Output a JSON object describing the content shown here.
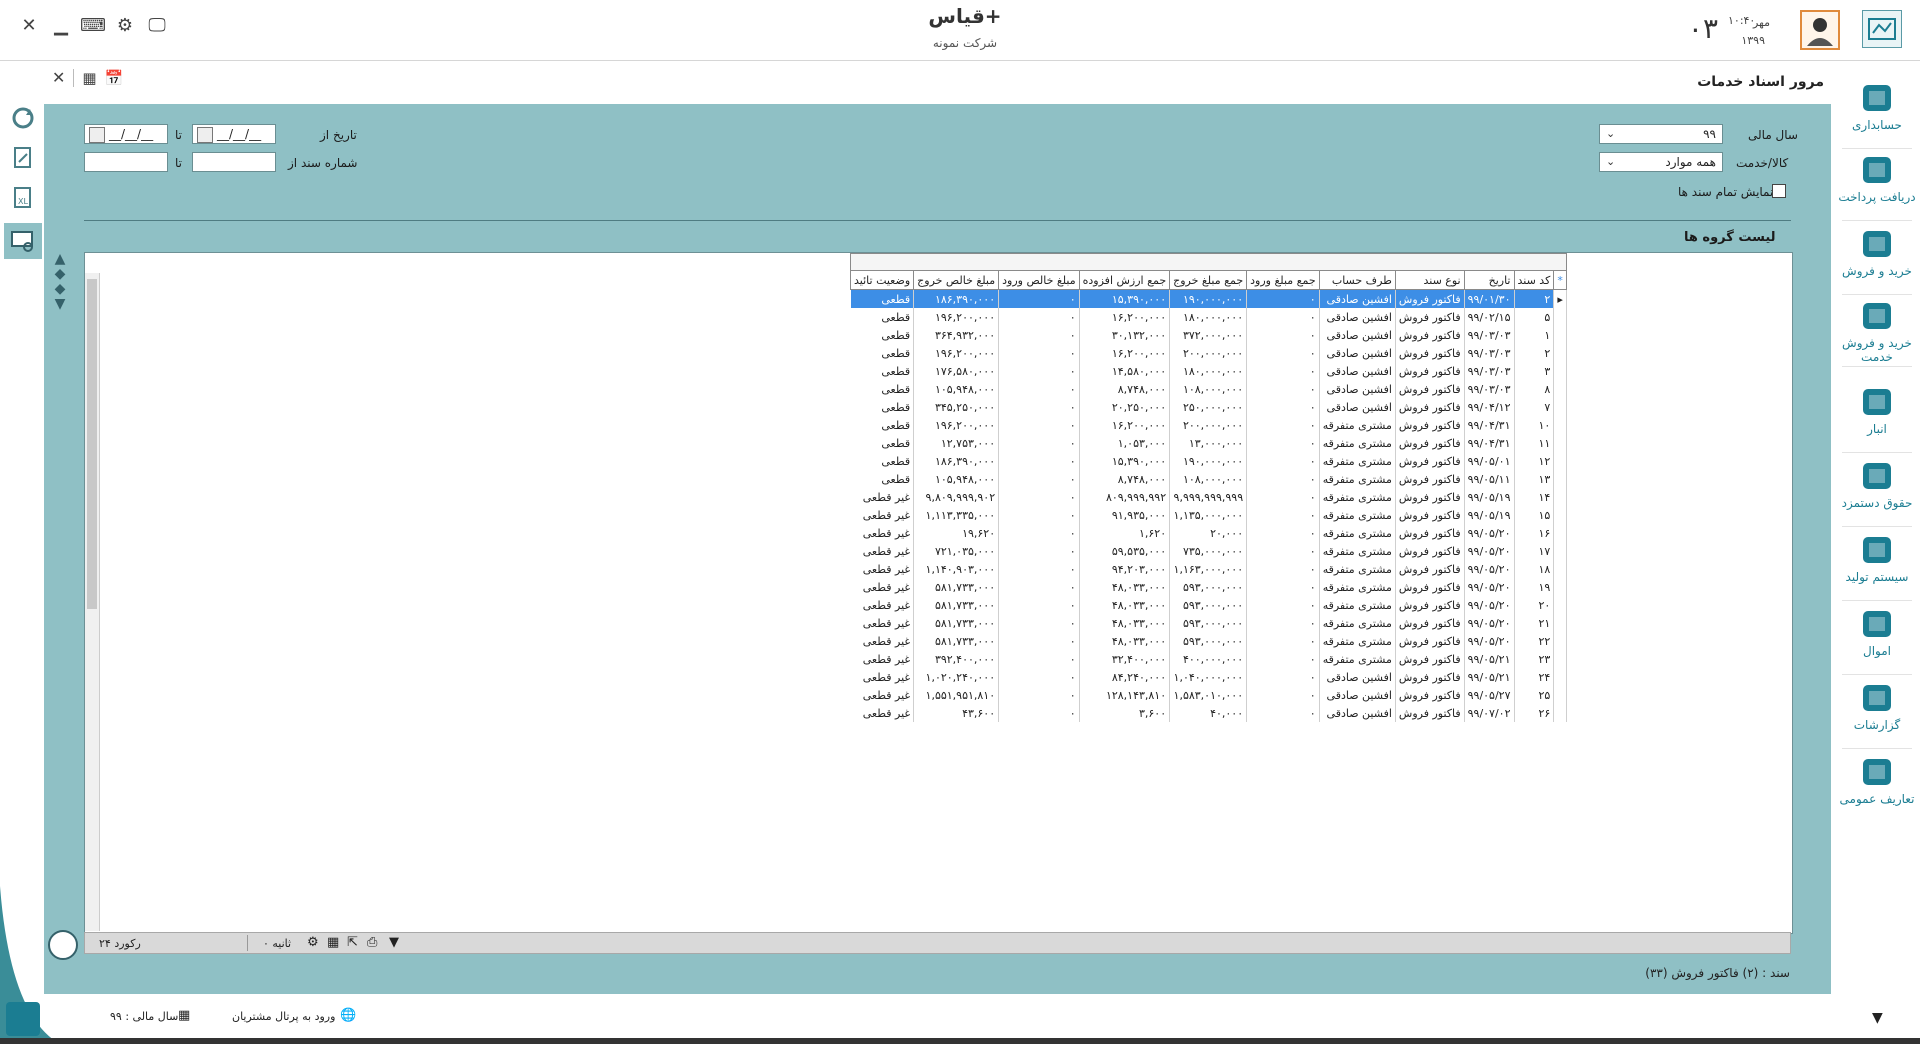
{
  "header": {
    "app_title": "قیاس+",
    "company": "شرکت نمونه",
    "date_day": "۰۳",
    "date_month": "مهر",
    "date_year": "۱۳۹۹",
    "clock": "۱۰:۴۰"
  },
  "page_title": "مرور اسناد خدمات",
  "nav": [
    {
      "label": "حسابداری",
      "icon": "calculator-icon"
    },
    {
      "label": "دریافت پرداخت",
      "icon": "safe-icon"
    },
    {
      "label": "خرید و فروش",
      "icon": "globe-cart-icon"
    },
    {
      "label": "خرید و فروش خدمت",
      "icon": "gear-service-icon"
    },
    {
      "label": "انبار",
      "icon": "warehouse-icon"
    },
    {
      "label": "حقوق دستمزد",
      "icon": "coins-icon"
    },
    {
      "label": "سیستم تولید",
      "icon": "worker-icon"
    },
    {
      "label": "اموال",
      "icon": "box-icon"
    },
    {
      "label": "گزارشات",
      "icon": "chart-icon"
    },
    {
      "label": "تعاریف عمومی",
      "icon": "table-icon"
    }
  ],
  "filters": {
    "fiscal_year_label": "سال مالی",
    "fiscal_year_value": "۹۹",
    "goods_label": "کالا/خدمت",
    "goods_value": "همه موارد",
    "show_all_label": "نمایش تمام سند ها",
    "date_from_label": "تاریخ از",
    "date_to_label": "تا",
    "date_placeholder": "__/__/__",
    "doc_from_label": "شماره سند از",
    "doc_to_label": "تا"
  },
  "list_title": "لیست گروه ها",
  "table": {
    "columns": [
      "کد سند",
      "تاریخ",
      "نوع سند",
      "طرف حساب",
      "جمع مبلغ ورود",
      "جمع مبلغ خروج",
      "جمع ارزش افزوده",
      "مبلغ خالص ورود",
      "مبلغ خالص خروج",
      "وضعیت تائید"
    ],
    "rows": [
      [
        "۲",
        "۹۹/۰۱/۳۰",
        "فاکتور فروش",
        "افشین صادقی",
        "۰",
        "۱۹۰,۰۰۰,۰۰۰",
        "۱۵,۳۹۰,۰۰۰",
        "۰",
        "۱۸۶,۳۹۰,۰۰۰",
        "قطعی"
      ],
      [
        "۵",
        "۹۹/۰۲/۱۵",
        "فاکتور فروش",
        "افشین صادقی",
        "۰",
        "۱۸۰,۰۰۰,۰۰۰",
        "۱۶,۲۰۰,۰۰۰",
        "۰",
        "۱۹۶,۲۰۰,۰۰۰",
        "قطعی"
      ],
      [
        "۱",
        "۹۹/۰۳/۰۳",
        "فاکتور فروش",
        "افشین صادقی",
        "۰",
        "۳۷۲,۰۰۰,۰۰۰",
        "۳۰,۱۳۲,۰۰۰",
        "۰",
        "۳۶۴,۹۳۲,۰۰۰",
        "قطعی"
      ],
      [
        "۲",
        "۹۹/۰۳/۰۳",
        "فاکتور فروش",
        "افشین صادقی",
        "۰",
        "۲۰۰,۰۰۰,۰۰۰",
        "۱۶,۲۰۰,۰۰۰",
        "۰",
        "۱۹۶,۲۰۰,۰۰۰",
        "قطعی"
      ],
      [
        "۳",
        "۹۹/۰۳/۰۳",
        "فاکتور فروش",
        "افشین صادقی",
        "۰",
        "۱۸۰,۰۰۰,۰۰۰",
        "۱۴,۵۸۰,۰۰۰",
        "۰",
        "۱۷۶,۵۸۰,۰۰۰",
        "قطعی"
      ],
      [
        "۸",
        "۹۹/۰۳/۰۳",
        "فاکتور فروش",
        "افشین صادقی",
        "۰",
        "۱۰۸,۰۰۰,۰۰۰",
        "۸,۷۴۸,۰۰۰",
        "۰",
        "۱۰۵,۹۴۸,۰۰۰",
        "قطعی"
      ],
      [
        "۷",
        "۹۹/۰۴/۱۲",
        "فاکتور فروش",
        "افشین صادقی",
        "۰",
        "۲۵۰,۰۰۰,۰۰۰",
        "۲۰,۲۵۰,۰۰۰",
        "۰",
        "۳۴۵,۲۵۰,۰۰۰",
        "قطعی"
      ],
      [
        "۱۰",
        "۹۹/۰۴/۳۱",
        "فاکتور فروش",
        "مشتری متفرقه",
        "۰",
        "۲۰۰,۰۰۰,۰۰۰",
        "۱۶,۲۰۰,۰۰۰",
        "۰",
        "۱۹۶,۲۰۰,۰۰۰",
        "قطعی"
      ],
      [
        "۱۱",
        "۹۹/۰۴/۳۱",
        "فاکتور فروش",
        "مشتری متفرقه",
        "۰",
        "۱۳,۰۰۰,۰۰۰",
        "۱,۰۵۳,۰۰۰",
        "۰",
        "۱۲,۷۵۳,۰۰۰",
        "قطعی"
      ],
      [
        "۱۲",
        "۹۹/۰۵/۰۱",
        "فاکتور فروش",
        "مشتری متفرقه",
        "۰",
        "۱۹۰,۰۰۰,۰۰۰",
        "۱۵,۳۹۰,۰۰۰",
        "۰",
        "۱۸۶,۳۹۰,۰۰۰",
        "قطعی"
      ],
      [
        "۱۳",
        "۹۹/۰۵/۱۱",
        "فاکتور فروش",
        "مشتری متفرقه",
        "۰",
        "۱۰۸,۰۰۰,۰۰۰",
        "۸,۷۴۸,۰۰۰",
        "۰",
        "۱۰۵,۹۴۸,۰۰۰",
        "قطعی"
      ],
      [
        "۱۴",
        "۹۹/۰۵/۱۹",
        "فاکتور فروش",
        "مشتری متفرقه",
        "۰",
        "۹,۹۹۹,۹۹۹,۹۹۹",
        "۸۰۹,۹۹۹,۹۹۲",
        "۰",
        "۹,۸۰۹,۹۹۹,۹۰۲",
        "غیر قطعی"
      ],
      [
        "۱۵",
        "۹۹/۰۵/۱۹",
        "فاکتور فروش",
        "مشتری متفرقه",
        "۰",
        "۱,۱۳۵,۰۰۰,۰۰۰",
        "۹۱,۹۳۵,۰۰۰",
        "۰",
        "۱,۱۱۳,۳۳۵,۰۰۰",
        "غیر قطعی"
      ],
      [
        "۱۶",
        "۹۹/۰۵/۲۰",
        "فاکتور فروش",
        "مشتری متفرقه",
        "۰",
        "۲۰,۰۰۰",
        "۱,۶۲۰",
        "۰",
        "۱۹,۶۲۰",
        "غیر قطعی"
      ],
      [
        "۱۷",
        "۹۹/۰۵/۲۰",
        "فاکتور فروش",
        "مشتری متفرقه",
        "۰",
        "۷۳۵,۰۰۰,۰۰۰",
        "۵۹,۵۳۵,۰۰۰",
        "۰",
        "۷۲۱,۰۳۵,۰۰۰",
        "غیر قطعی"
      ],
      [
        "۱۸",
        "۹۹/۰۵/۲۰",
        "فاکتور فروش",
        "مشتری متفرقه",
        "۰",
        "۱,۱۶۳,۰۰۰,۰۰۰",
        "۹۴,۲۰۳,۰۰۰",
        "۰",
        "۱,۱۴۰,۹۰۳,۰۰۰",
        "غیر قطعی"
      ],
      [
        "۱۹",
        "۹۹/۰۵/۲۰",
        "فاکتور فروش",
        "مشتری متفرقه",
        "۰",
        "۵۹۳,۰۰۰,۰۰۰",
        "۴۸,۰۳۳,۰۰۰",
        "۰",
        "۵۸۱,۷۳۳,۰۰۰",
        "غیر قطعی"
      ],
      [
        "۲۰",
        "۹۹/۰۵/۲۰",
        "فاکتور فروش",
        "مشتری متفرقه",
        "۰",
        "۵۹۳,۰۰۰,۰۰۰",
        "۴۸,۰۳۳,۰۰۰",
        "۰",
        "۵۸۱,۷۳۳,۰۰۰",
        "غیر قطعی"
      ],
      [
        "۲۱",
        "۹۹/۰۵/۲۰",
        "فاکتور فروش",
        "مشتری متفرقه",
        "۰",
        "۵۹۳,۰۰۰,۰۰۰",
        "۴۸,۰۳۳,۰۰۰",
        "۰",
        "۵۸۱,۷۳۳,۰۰۰",
        "غیر قطعی"
      ],
      [
        "۲۲",
        "۹۹/۰۵/۲۰",
        "فاکتور فروش",
        "مشتری متفرقه",
        "۰",
        "۵۹۳,۰۰۰,۰۰۰",
        "۴۸,۰۳۳,۰۰۰",
        "۰",
        "۵۸۱,۷۳۳,۰۰۰",
        "غیر قطعی"
      ],
      [
        "۲۳",
        "۹۹/۰۵/۲۱",
        "فاکتور فروش",
        "مشتری متفرقه",
        "۰",
        "۴۰۰,۰۰۰,۰۰۰",
        "۳۲,۴۰۰,۰۰۰",
        "۰",
        "۳۹۲,۴۰۰,۰۰۰",
        "غیر قطعی"
      ],
      [
        "۲۴",
        "۹۹/۰۵/۲۱",
        "فاکتور فروش",
        "افشین صادقی",
        "۰",
        "۱,۰۴۰,۰۰۰,۰۰۰",
        "۸۴,۲۴۰,۰۰۰",
        "۰",
        "۱,۰۲۰,۲۴۰,۰۰۰",
        "غیر قطعی"
      ],
      [
        "۲۵",
        "۹۹/۰۵/۲۷",
        "فاکتور فروش",
        "افشین صادقی",
        "۰",
        "۱,۵۸۳,۰۱۰,۰۰۰",
        "۱۲۸,۱۴۳,۸۱۰",
        "۰",
        "۱,۵۵۱,۹۵۱,۸۱۰",
        "غیر قطعی"
      ],
      [
        "۲۶",
        "۹۹/۰۷/۰۲",
        "فاکتور فروش",
        "افشین صادقی",
        "۰",
        "۴۰,۰۰۰",
        "۳,۶۰۰",
        "۰",
        "۴۳,۶۰۰",
        "غیر قطعی"
      ]
    ]
  },
  "statusbar": {
    "record_count": "۲۴ رکورد",
    "seconds": "۰ ثانیه"
  },
  "footer": {
    "doc_label": "سند :",
    "doc_value": "(۲) فاکتور فروش (۳۳)",
    "fiscal_year": "سال مالی : ۹۹",
    "portal": "ورود به پرتال مشتریان"
  },
  "colors": {
    "panel": "#8fc0c5",
    "accent": "#1b7d92",
    "selection": "#3d8ee6"
  }
}
